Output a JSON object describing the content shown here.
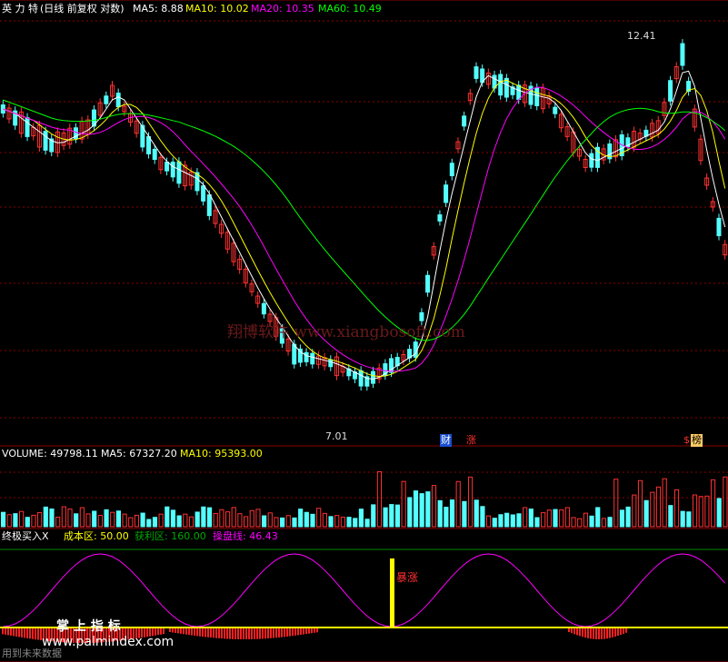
{
  "main_panel": {
    "stock_name": "英 力 特",
    "mode": "(日线 前复权 对数)",
    "ma": [
      {
        "label": "MA5: 8.88",
        "color": "#ffffff"
      },
      {
        "label": "MA10: 10.02",
        "color": "#ffff00"
      },
      {
        "label": "MA20: 10.35",
        "color": "#ff00ff"
      },
      {
        "label": "MA60: 10.49",
        "color": "#00ff00"
      }
    ],
    "high_label": "12.41",
    "low_label": "7.01",
    "watermark": "翔博软件 www.xiangbosoft.com",
    "event_markers": [
      {
        "text": "财",
        "color": "#ffffff",
        "bg": "#1a4fd0"
      },
      {
        "text": "涨",
        "color": "#ff3030",
        "bg": "#000000"
      },
      {
        "text": "$",
        "color": "#ff3030",
        "bg": "#000000"
      },
      {
        "text": "榜",
        "color": "#000000",
        "bg": "#ffcc66"
      }
    ]
  },
  "volume_panel": {
    "items": [
      {
        "label": "VOLUME: 49798.11",
        "color": "#ffffff"
      },
      {
        "label": "MA5: 67327.20",
        "color": "#ffffff"
      },
      {
        "label": "MA10: 95393.00",
        "color": "#ffff00"
      }
    ]
  },
  "indicator_panel": {
    "title": "终极买入X",
    "items": [
      {
        "label": "成本区: 50.00",
        "color": "#ffff00"
      },
      {
        "label": "获利区: 160.00",
        "color": "#00aa00"
      },
      {
        "label": "操盘线: 46.43",
        "color": "#ff00ff"
      }
    ],
    "signal_text": "暴涨",
    "brand_text": "掌 上 指 标",
    "brand_url": "www.palmindex.com",
    "brand_sub": "用到未来数据"
  },
  "colors": {
    "up": "#ff3232",
    "down": "#54ffff",
    "ma5": "#ffffff",
    "ma10": "#ffff00",
    "ma20": "#ff00ff",
    "ma60": "#00ff00",
    "grid": "#8b0000"
  }
}
